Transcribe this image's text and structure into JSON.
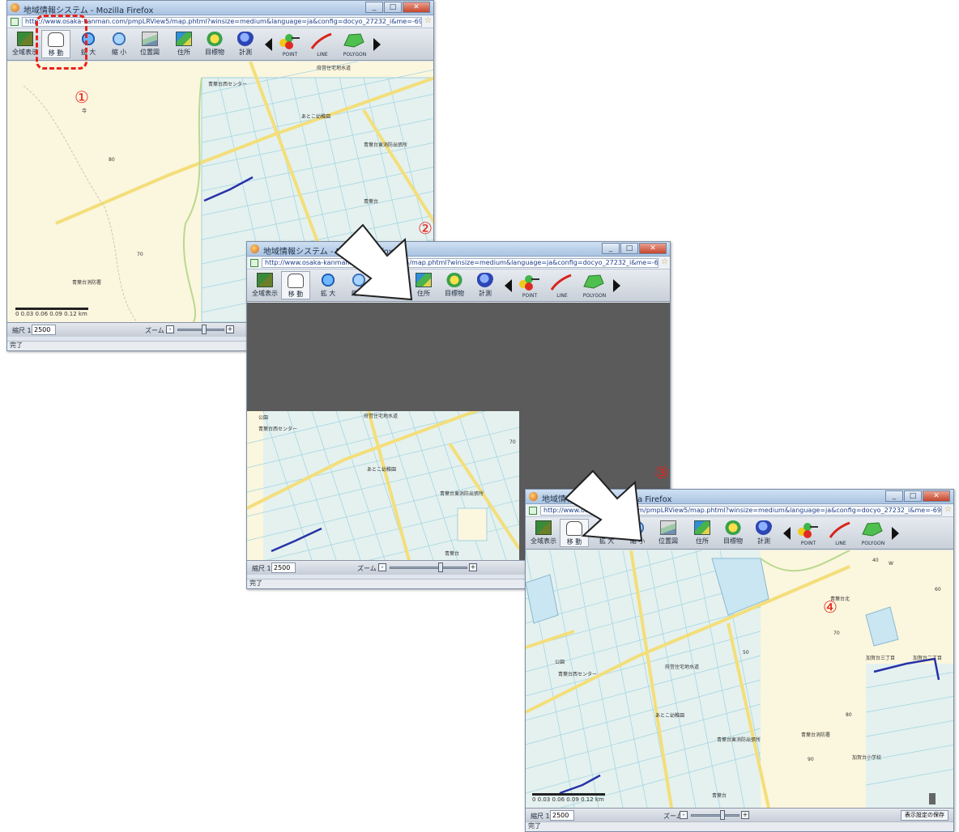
{
  "window": {
    "title": "地域情報システム - Mozilla Firefox",
    "url": "http://www.osaka-kanman.com/pmpLRView5/map.phtml?winsize=medium&language=ja&config=docyo_27232_i&me=-69557.0703125,-182733.4375,-...",
    "status_done": "完了"
  },
  "toolbar": {
    "full_view": "全域表示",
    "move": "移 動",
    "zoom_in": "拡 大",
    "zoom_out": "縮 小",
    "location_map": "位置図",
    "address": "住所",
    "landmark": "目標物",
    "measure": "計測",
    "point": "POINT",
    "line": "LINE",
    "polygon": "POLYGON"
  },
  "mapbar": {
    "scale_label": "縮尺 1:",
    "scale_value": "2500",
    "zoom_label": "ズーム",
    "zoom_minus": "-",
    "zoom_plus": "+",
    "extra_button": "表示設定の保存"
  },
  "scalebar": {
    "ticks": "0   0.03  0.06  0.09  0.12 km"
  },
  "annotations": {
    "step1": "①",
    "step2": "②",
    "step3": "③",
    "step4": "④"
  },
  "map_labels": {
    "park": "公園",
    "center": "青葉台西センター",
    "playground": "府営住宅地水道",
    "school": "あとこ幼稚園",
    "office": "青葉台東消防出張所",
    "station": "青葉台",
    "n70": "70",
    "n60": "60",
    "n50": "50",
    "n80": "80",
    "n90": "90",
    "n40": "40",
    "fire": "青葉台消防署",
    "upper_north": "青葉台北",
    "sanchome": "加賀台三丁目",
    "nichome": "加賀台二丁目",
    "shogakko": "加賀台小学校",
    "w": "W"
  }
}
